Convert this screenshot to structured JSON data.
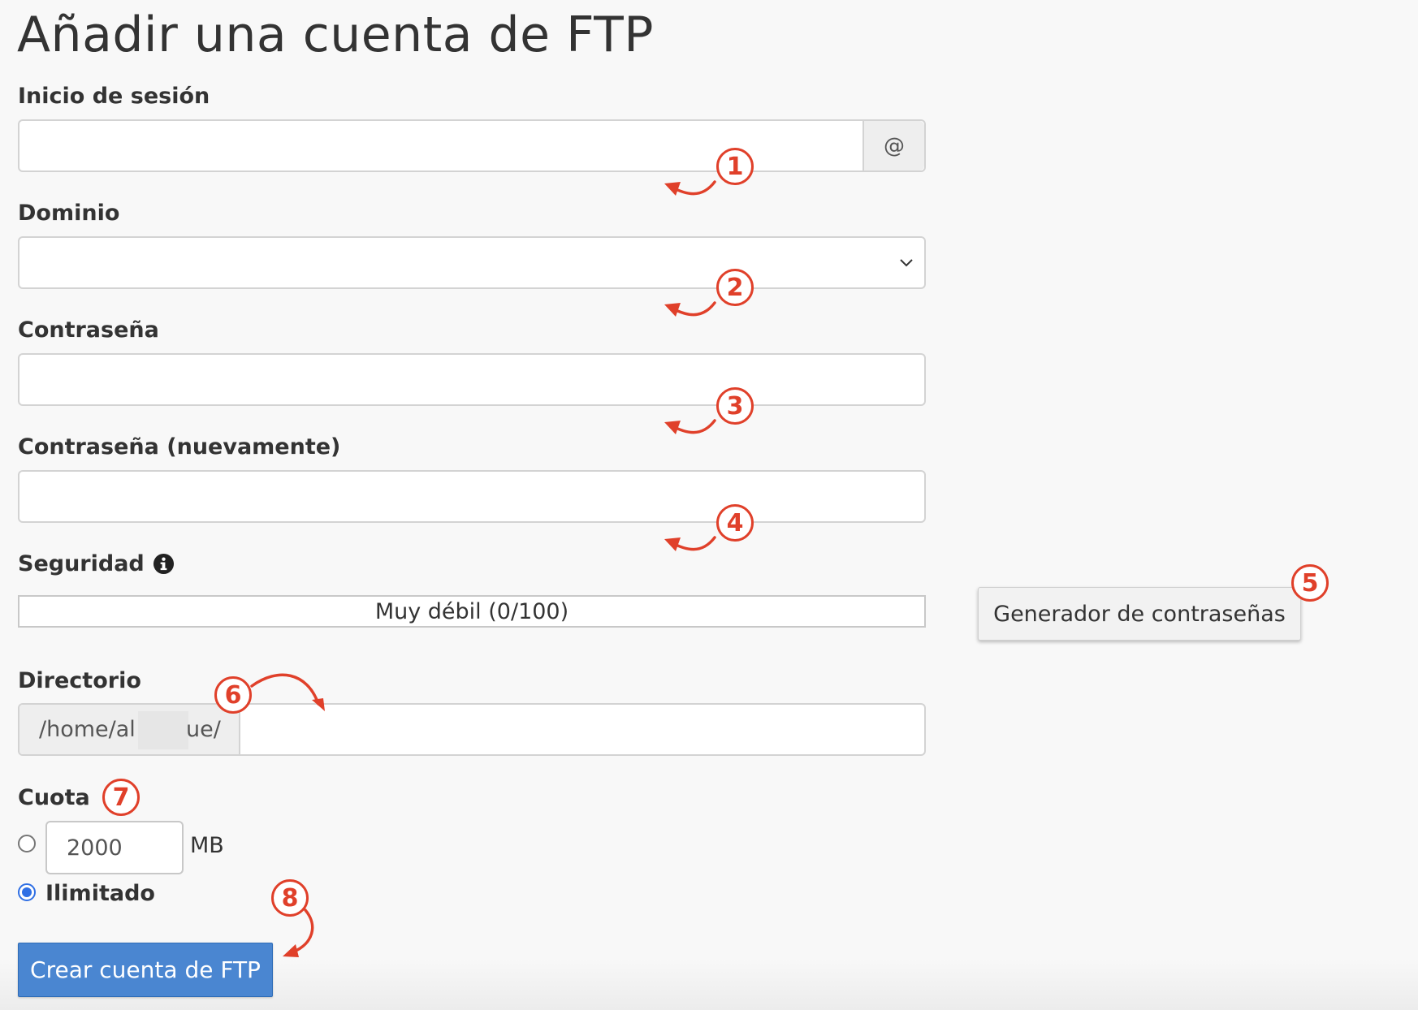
{
  "page_title": "Añadir una cuenta de FTP",
  "login": {
    "label": "Inicio de sesión",
    "value": "",
    "addon": "@"
  },
  "domain": {
    "label": "Dominio",
    "selected": ""
  },
  "password": {
    "label": "Contraseña",
    "value": ""
  },
  "password_again": {
    "label": "Contraseña (nuevamente)",
    "value": ""
  },
  "security": {
    "label": "Seguridad",
    "strength_text": "Muy débil (0/100)",
    "strength_value": 0
  },
  "generator_button": "Generador de contraseñas",
  "directory": {
    "label": "Directorio",
    "prefix_start": "/home/al",
    "prefix_end": "ue/",
    "value": ""
  },
  "quota": {
    "label": "Cuota",
    "value": "2000",
    "unit": "MB",
    "unlimited_label": "Ilimitado",
    "unlimited_selected": true
  },
  "submit_button": "Crear cuenta de FTP",
  "annotations": [
    "1",
    "2",
    "3",
    "4",
    "5",
    "6",
    "7",
    "8"
  ],
  "colors": {
    "annotation": "#e0402a",
    "primary_button": "#4a86d1",
    "radio_checked": "#2f6fe4"
  }
}
